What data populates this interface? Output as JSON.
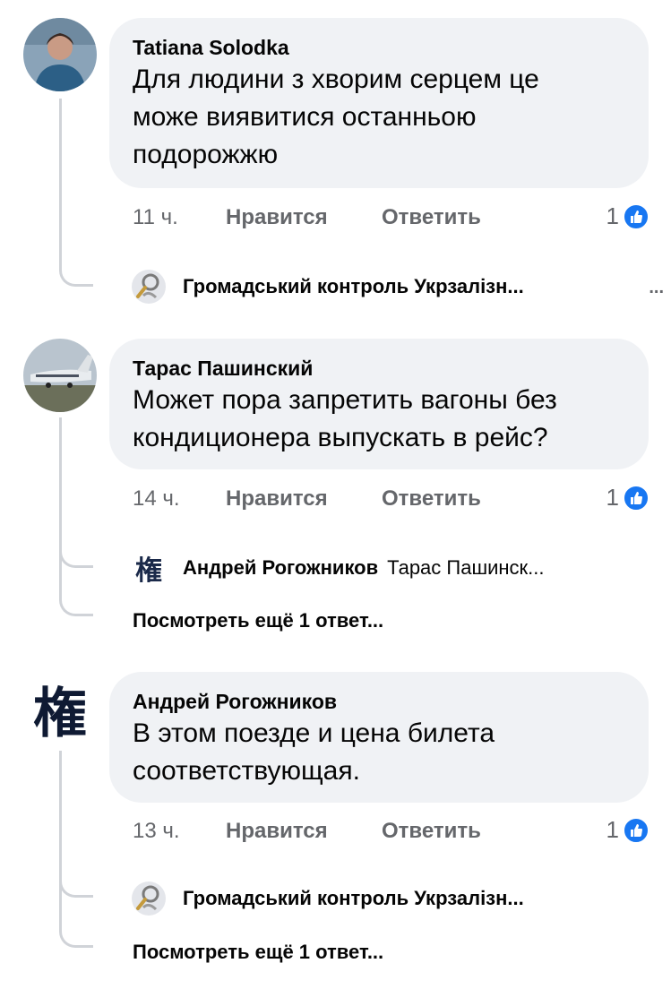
{
  "comments": [
    {
      "author": "Tatiana Solodka",
      "text": "Для людини з хворим серцем це може виявитися останньою подорожжю",
      "time": "11 ч.",
      "like_label": "Нравится",
      "reply_label": "Ответить",
      "reaction_count": "1",
      "reply_preview": {
        "name": "Громадський контроль Укрзалізн...",
        "sub": "",
        "more_dots": "..."
      }
    },
    {
      "author": "Тарас Пашинский",
      "text": "Может пора запретить вагоны без кондиционера выпускать в рейс?",
      "time": "14 ч.",
      "like_label": "Нравится",
      "reply_label": "Ответить",
      "reaction_count": "1",
      "reply_preview": {
        "name": "Андрей Рогожников",
        "sub": "Тарас Пашинск...",
        "avatar_glyph": "権"
      },
      "view_more": "Посмотреть ещё 1 ответ..."
    },
    {
      "author": "Андрей Рогожников",
      "avatar_glyph": "権",
      "text": "В этом поезде и цена билета соответствующая.",
      "time": "13 ч.",
      "like_label": "Нравится",
      "reply_label": "Ответить",
      "reaction_count": "1",
      "reply_preview": {
        "name": "Громадський контроль Укрзалізн...",
        "sub": ""
      },
      "view_more": "Посмотреть ещё 1 ответ..."
    }
  ],
  "colors": {
    "bubble": "#f0f2f5",
    "meta": "#65676b",
    "like_blue": "#1877f2"
  }
}
